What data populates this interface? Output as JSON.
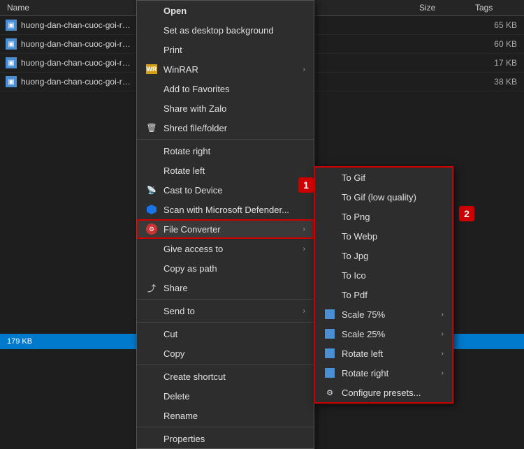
{
  "explorer": {
    "columns": {
      "name": "Name",
      "size": "Size",
      "tags": "Tags"
    },
    "files": [
      {
        "name": "huong-dan-chan-cuoc-goi-rac-tre",
        "size": "65 KB"
      },
      {
        "name": "huong-dan-chan-cuoc-goi-rac-tre",
        "size": "60 KB"
      },
      {
        "name": "huong-dan-chan-cuoc-goi-rac-tre",
        "size": "17 KB"
      },
      {
        "name": "huong-dan-chan-cuoc-goi-rac-tre",
        "size": "38 KB"
      }
    ]
  },
  "status_bar": {
    "text": "179 KB"
  },
  "context_menu_1": {
    "items": [
      {
        "id": "open",
        "label": "Open",
        "icon": ""
      },
      {
        "id": "set-desktop",
        "label": "Set as desktop background",
        "icon": "",
        "arrow": false
      },
      {
        "id": "print",
        "label": "Print",
        "icon": "",
        "arrow": false
      },
      {
        "id": "winrar",
        "label": "WinRAR",
        "icon": "winrar",
        "arrow": true
      },
      {
        "id": "add-favorites",
        "label": "Add to Favorites",
        "icon": "",
        "arrow": false
      },
      {
        "id": "share-zalo",
        "label": "Share with Zalo",
        "icon": "",
        "arrow": false
      },
      {
        "id": "shred",
        "label": "Shred file/folder",
        "icon": "",
        "arrow": false
      },
      {
        "id": "rotate-right",
        "label": "Rotate right",
        "icon": "",
        "arrow": false
      },
      {
        "id": "rotate-left",
        "label": "Rotate left",
        "icon": "",
        "arrow": false
      },
      {
        "id": "cast",
        "label": "Cast to Device",
        "icon": "cast",
        "arrow": true
      },
      {
        "id": "scan-defender",
        "label": "Scan with Microsoft Defender...",
        "icon": "defender",
        "arrow": false
      },
      {
        "id": "file-converter",
        "label": "File Converter",
        "icon": "converter",
        "arrow": true,
        "highlighted": true
      },
      {
        "id": "give-access",
        "label": "Give access to",
        "icon": "",
        "arrow": true
      },
      {
        "id": "copy-path",
        "label": "Copy as path",
        "icon": "",
        "arrow": false
      },
      {
        "id": "share",
        "label": "Share",
        "icon": "share",
        "arrow": false
      },
      {
        "id": "send-to",
        "label": "Send to",
        "icon": "",
        "arrow": true
      },
      {
        "id": "cut",
        "label": "Cut",
        "icon": "",
        "arrow": false
      },
      {
        "id": "copy",
        "label": "Copy",
        "icon": "",
        "arrow": false
      },
      {
        "id": "create-shortcut",
        "label": "Create shortcut",
        "icon": "",
        "arrow": false
      },
      {
        "id": "delete",
        "label": "Delete",
        "icon": "",
        "arrow": false
      },
      {
        "id": "rename",
        "label": "Rename",
        "icon": "",
        "arrow": false
      },
      {
        "id": "properties",
        "label": "Properties",
        "icon": "",
        "arrow": false
      }
    ]
  },
  "context_menu_2": {
    "items": [
      {
        "id": "to-gif",
        "label": "To Gif",
        "icon": "",
        "arrow": false
      },
      {
        "id": "to-gif-low",
        "label": "To Gif (low quality)",
        "icon": "",
        "arrow": false
      },
      {
        "id": "to-png",
        "label": "To Png",
        "icon": "",
        "arrow": false
      },
      {
        "id": "to-webp",
        "label": "To Webp",
        "icon": "",
        "arrow": false
      },
      {
        "id": "to-jpg",
        "label": "To Jpg",
        "icon": "",
        "arrow": false
      },
      {
        "id": "to-ico",
        "label": "To Ico",
        "icon": "",
        "arrow": false
      },
      {
        "id": "to-pdf",
        "label": "To Pdf",
        "icon": "",
        "arrow": false
      },
      {
        "id": "scale-75",
        "label": "Scale 75%",
        "icon": "blue",
        "arrow": true
      },
      {
        "id": "scale-25",
        "label": "Scale 25%",
        "icon": "blue",
        "arrow": true
      },
      {
        "id": "rotate-left",
        "label": "Rotate left",
        "icon": "blue",
        "arrow": true
      },
      {
        "id": "rotate-right",
        "label": "Rotate right",
        "icon": "blue",
        "arrow": true
      },
      {
        "id": "configure",
        "label": "Configure presets...",
        "icon": "gear",
        "arrow": false
      }
    ]
  },
  "badges": {
    "badge1": "1",
    "badge2": "2"
  }
}
